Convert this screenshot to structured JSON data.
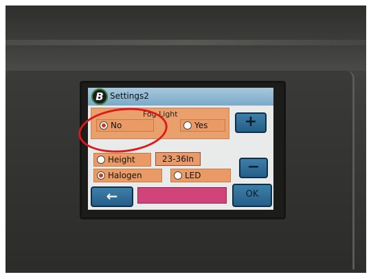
{
  "screen": {
    "title": "Settings2",
    "logo_letter": "B",
    "fog_light": {
      "label": "Fog Light",
      "options": [
        {
          "label": "No",
          "selected": true
        },
        {
          "label": "Yes",
          "selected": false
        }
      ]
    },
    "height": {
      "label": "Height",
      "selected": false,
      "value": "23-36In"
    },
    "lamp_type": {
      "options": [
        {
          "label": "Halogen",
          "selected": true
        },
        {
          "label": "LED",
          "selected": false
        }
      ]
    },
    "buttons": {
      "plus": "+",
      "minus": "−",
      "back": "←",
      "ok": "OK"
    }
  },
  "annotation_color": "#e01818",
  "accent_colors": {
    "title_bar": "#7aaac8",
    "option_fill": "#ea9a64",
    "button_blue": "#245f88",
    "message_bar": "#d0447a"
  }
}
